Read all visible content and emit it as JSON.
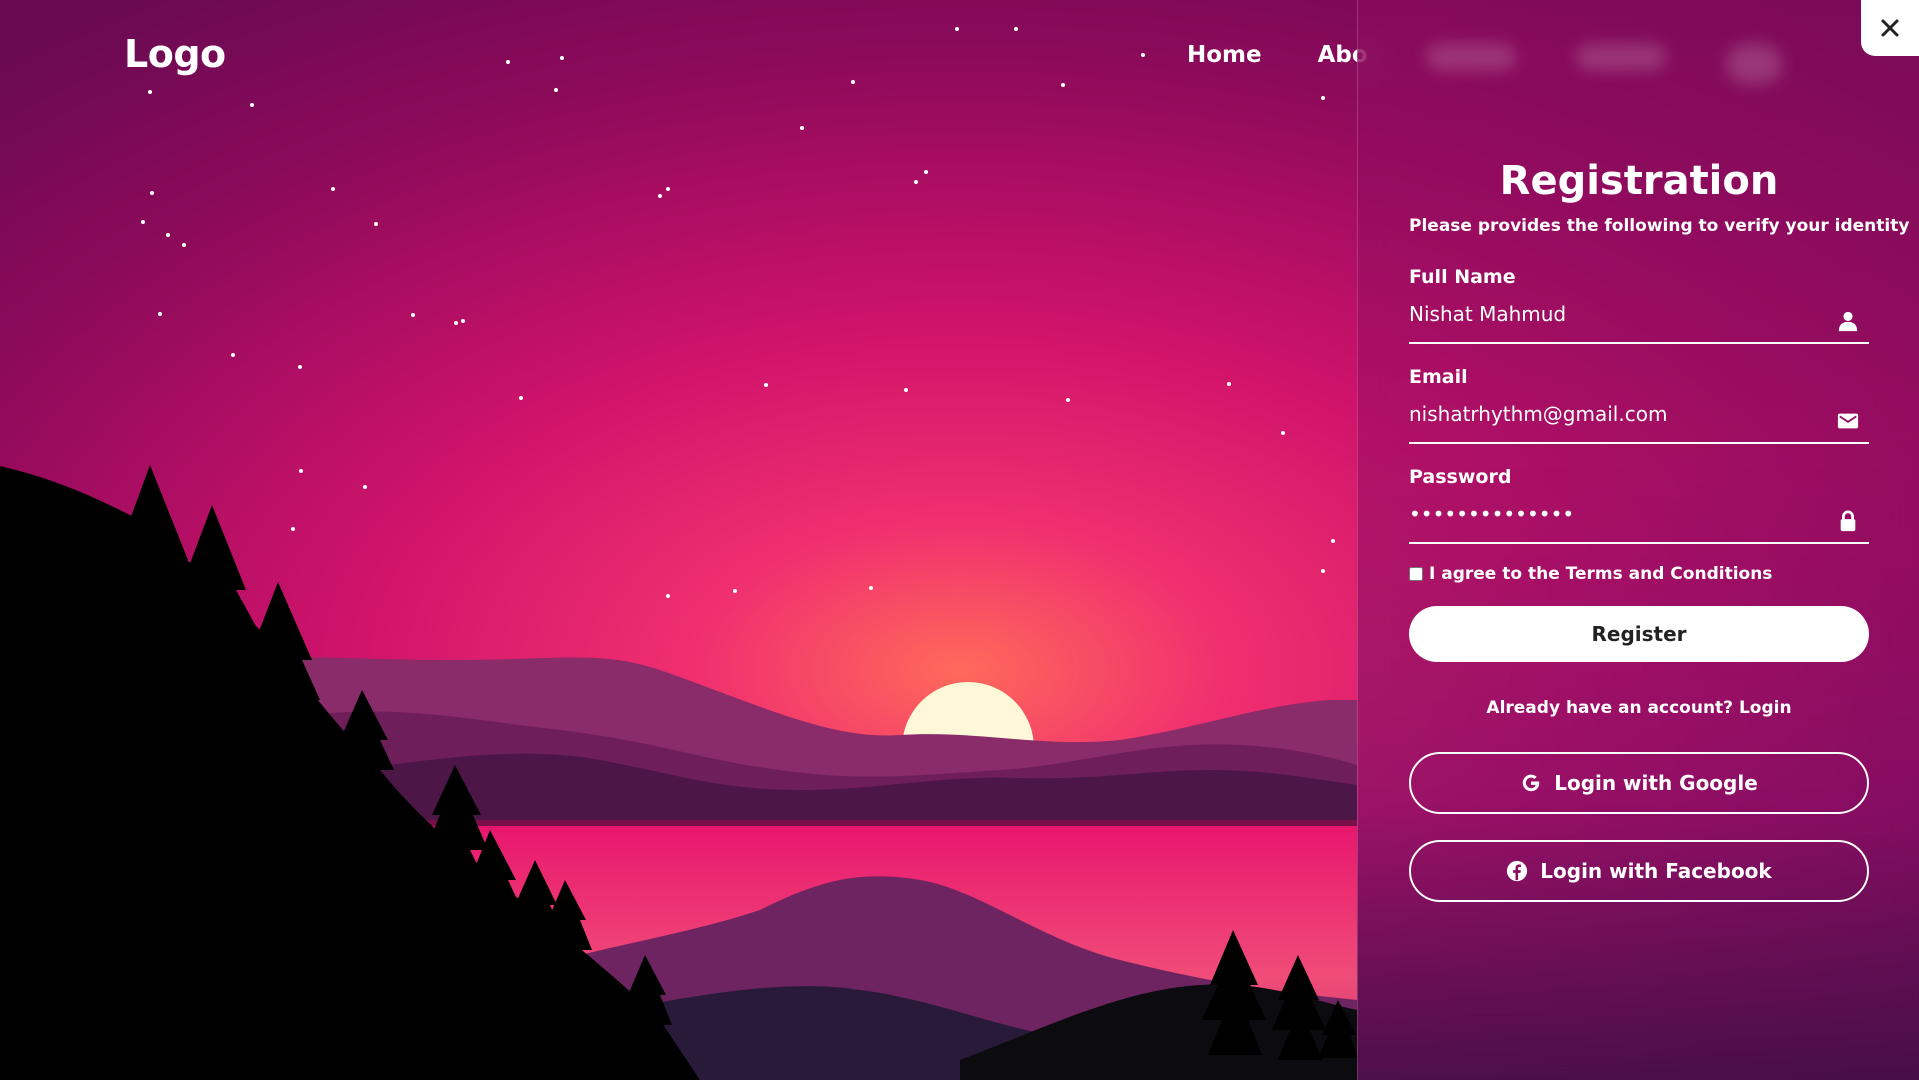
{
  "header": {
    "logo": "Logo",
    "nav": [
      "Home",
      "Abo"
    ]
  },
  "form": {
    "title": "Registration",
    "subtitle": "Please provides the following to verify your identity",
    "fields": [
      {
        "label": "Full Name",
        "value": "Nishat Mahmud",
        "icon": "user-icon"
      },
      {
        "label": "Email",
        "value": "nishatrhythm@gmail.com",
        "icon": "mail-icon"
      },
      {
        "label": "Password",
        "value": "••••••••••••••",
        "icon": "lock-icon"
      }
    ],
    "agree_label": "I agree to the Terms and Conditions",
    "register_label": "Register",
    "already_text": "Already have an account?",
    "login_link": "Login",
    "google_label": "Login with Google",
    "facebook_label": "Login with Facebook"
  },
  "close_icon": "close-icon",
  "colors": {
    "sky_top": "#7a0a55",
    "sky_glow": "#e0186e",
    "sun": "#fff7d6",
    "lake": "#e81e72",
    "silhouette": "#000000"
  }
}
